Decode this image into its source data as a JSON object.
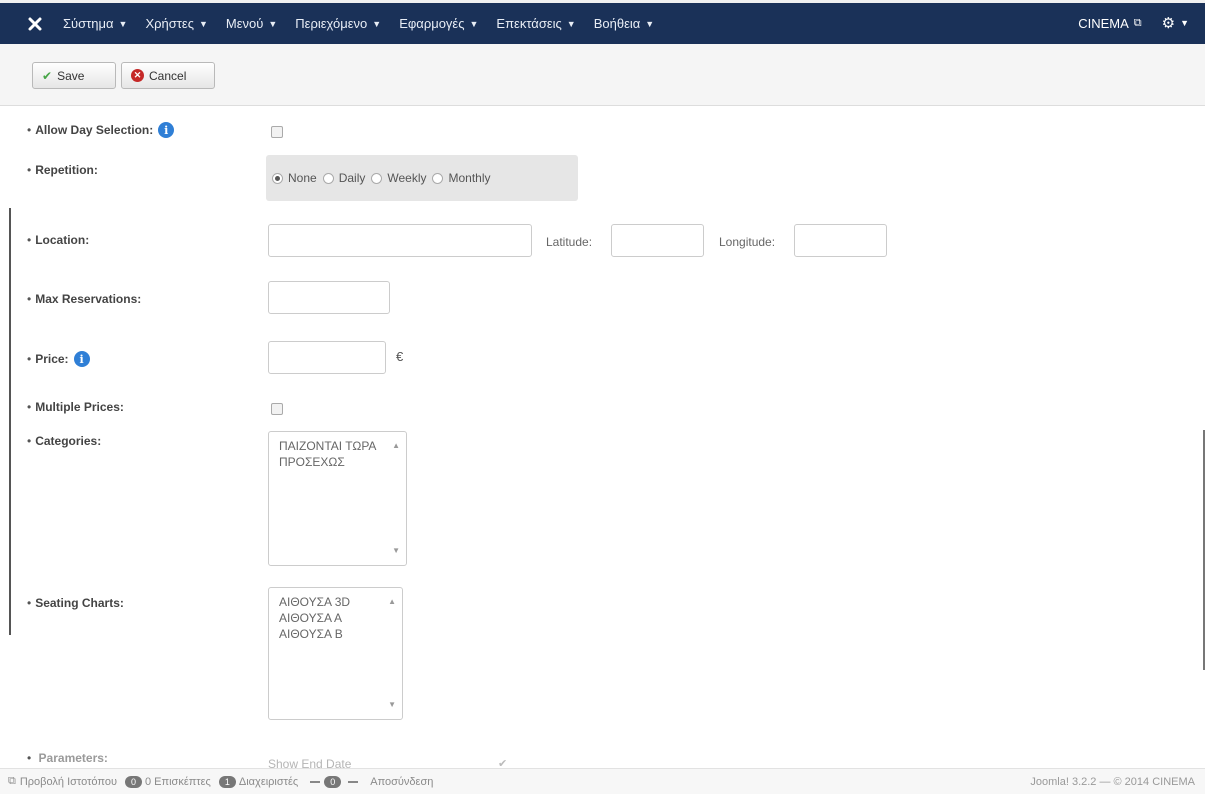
{
  "navbar": {
    "brand_icon": "joomla-logo-icon",
    "menu": [
      {
        "label": "Σύστημα"
      },
      {
        "label": "Χρήστες"
      },
      {
        "label": "Μενού"
      },
      {
        "label": "Περιεχόμενο"
      },
      {
        "label": "Εφαρμογές"
      },
      {
        "label": "Επεκτάσεις"
      },
      {
        "label": "Βοήθεια"
      }
    ],
    "site_name": "CINEMA",
    "site_icon": "external-link-icon",
    "settings_icon": "gear-icon"
  },
  "toolbar": {
    "save_label": "Save",
    "cancel_label": "Cancel"
  },
  "form": {
    "allow_day_selection_label": "Allow Day Selection:",
    "repetition_label": "Repetition:",
    "repetition_options": [
      "None",
      "Daily",
      "Weekly",
      "Monthly"
    ],
    "repetition_selected": "None",
    "location_label": "Location:",
    "latitude_label": "Latitude:",
    "longitude_label": "Longitude:",
    "max_reservations_label": "Max Reservations:",
    "price_label": "Price:",
    "currency_symbol": "€",
    "multiple_prices_label": "Multiple Prices:",
    "categories_label": "Categories:",
    "categories_options": [
      "ΠΑΙΖΟΝΤΑΙ ΤΩΡΑ",
      "ΠΡΟΣΕΧΩΣ"
    ],
    "seating_charts_label": "Seating Charts:",
    "seating_charts_options": [
      "ΑΙΘΟΥΣΑ 3D",
      "ΑΙΘΟΥΣΑ Α",
      "ΑΙΘΟΥΣΑ Β"
    ],
    "parameters_label": "Parameters:",
    "show_end_date_label": "Show End Date"
  },
  "statusbar": {
    "view_site": "Προβολή Ιστοτόπου",
    "visitors_count": "0",
    "visitors_label": "0 Επισκέπτες",
    "admins_count": "1",
    "admins_label": "Διαχειριστές",
    "messages_count": "0",
    "logout": "Αποσύνδεση",
    "version": "Joomla! 3.2.2 — © 2014 CINEMA"
  },
  "colors": {
    "navbar_bg": "#1a3158",
    "toolbar_bg": "#f5f5f5",
    "info_icon": "#2f7fd6",
    "cancel_icon": "#c52827",
    "save_check": "#46a546"
  }
}
